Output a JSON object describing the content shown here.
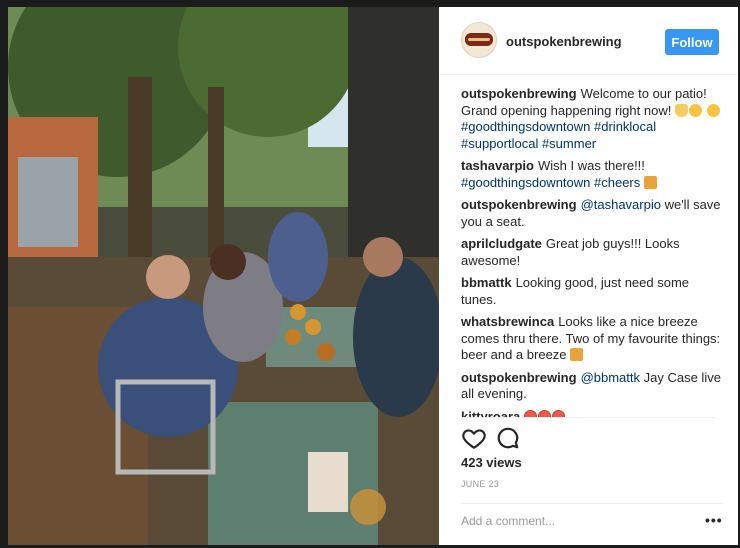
{
  "post": {
    "username": "outspokenbrewing",
    "follow_label": "Follow",
    "comments": [
      {
        "user": "outspokenbrewing",
        "parts": [
          {
            "t": "text",
            "v": "Welcome to our patio! Grand opening happening right now! "
          },
          {
            "t": "emoji",
            "v": "raised-hands",
            "c": "hands"
          },
          {
            "t": "emoji",
            "v": "flushed-face",
            "c": "yellow"
          },
          {
            "t": "text",
            "v": " "
          },
          {
            "t": "emoji",
            "v": "smiling-face",
            "c": "yellow"
          },
          {
            "t": "text",
            "v": " "
          },
          {
            "t": "tag",
            "v": "#goodthingsdowntown"
          },
          {
            "t": "text",
            "v": " "
          },
          {
            "t": "tag",
            "v": "#drinklocal"
          },
          {
            "t": "text",
            "v": " "
          },
          {
            "t": "tag",
            "v": "#supportlocal"
          },
          {
            "t": "text",
            "v": " "
          },
          {
            "t": "tag",
            "v": "#summer"
          }
        ]
      },
      {
        "user": "tashavarpio",
        "parts": [
          {
            "t": "text",
            "v": "Wish I was there!!! "
          },
          {
            "t": "tag",
            "v": "#goodthingsdowntown"
          },
          {
            "t": "text",
            "v": " "
          },
          {
            "t": "tag",
            "v": "#cheers"
          },
          {
            "t": "text",
            "v": " "
          },
          {
            "t": "emoji",
            "v": "beer-mugs",
            "c": "beer"
          }
        ]
      },
      {
        "user": "outspokenbrewing",
        "parts": [
          {
            "t": "tag",
            "v": "@tashavarpio"
          },
          {
            "t": "text",
            "v": " we'll save you a seat."
          }
        ]
      },
      {
        "user": "aprilcludgate",
        "parts": [
          {
            "t": "text",
            "v": "Great job guys!!! Looks awesome!"
          }
        ]
      },
      {
        "user": "bbmattk",
        "parts": [
          {
            "t": "text",
            "v": "Looking good, just need some tunes."
          }
        ]
      },
      {
        "user": "whatsbrewinca",
        "parts": [
          {
            "t": "text",
            "v": "Looks like a nice breeze comes thru there. Two of my favourite things: beer and a breeze "
          },
          {
            "t": "emoji",
            "v": "beer-mugs",
            "c": "beer"
          }
        ]
      },
      {
        "user": "outspokenbrewing",
        "parts": [
          {
            "t": "tag",
            "v": "@bbmattk"
          },
          {
            "t": "text",
            "v": " Jay Case live all evening."
          }
        ]
      },
      {
        "user": "kittyroara",
        "parts": [
          {
            "t": "emoji",
            "v": "heart-eyes",
            "c": "red"
          },
          {
            "t": "emoji",
            "v": "heart-eyes",
            "c": "red"
          },
          {
            "t": "emoji",
            "v": "heart-eyes",
            "c": "red"
          }
        ]
      }
    ],
    "views": "423 views",
    "date": "JUNE 23",
    "add_comment_placeholder": "Add a comment...",
    "more_label": "•••"
  },
  "colors": {
    "accent": "#3897f0",
    "text": "#262626",
    "muted": "#999999",
    "link": "#003569"
  },
  "icons": {
    "like": "heart-outline-icon",
    "comment": "speech-bubble-icon",
    "more": "ellipsis-icon"
  }
}
